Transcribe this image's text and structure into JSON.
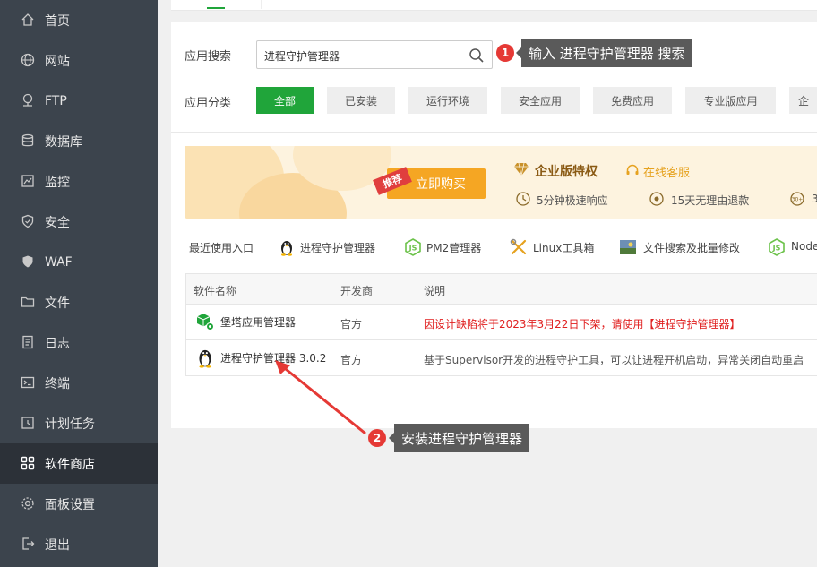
{
  "sidebar": {
    "items": [
      {
        "label": "首页",
        "icon": "home-icon"
      },
      {
        "label": "网站",
        "icon": "globe-icon"
      },
      {
        "label": "FTP",
        "icon": "ftp-icon"
      },
      {
        "label": "数据库",
        "icon": "database-icon"
      },
      {
        "label": "监控",
        "icon": "monitor-icon"
      },
      {
        "label": "安全",
        "icon": "shield-icon"
      },
      {
        "label": "WAF",
        "icon": "waf-shield-icon"
      },
      {
        "label": "文件",
        "icon": "folder-icon"
      },
      {
        "label": "日志",
        "icon": "log-icon"
      },
      {
        "label": "终端",
        "icon": "terminal-icon"
      },
      {
        "label": "计划任务",
        "icon": "clock-icon"
      },
      {
        "label": "软件商店",
        "icon": "apps-grid-icon",
        "active": true
      },
      {
        "label": "面板设置",
        "icon": "gear-icon"
      },
      {
        "label": "退出",
        "icon": "logout-icon"
      }
    ]
  },
  "search": {
    "label": "应用搜索",
    "value": "进程守护管理器"
  },
  "category": {
    "label": "应用分类",
    "items": [
      "全部",
      "已安装",
      "运行环境",
      "安全应用",
      "免费应用",
      "专业版应用",
      "企"
    ]
  },
  "banner": {
    "badge": "推荐",
    "buy": "立即购买",
    "title": "企业版特权",
    "service": "在线客服",
    "perk1": "5分钟极速响应",
    "perk2": "15天无理由退款",
    "perk3": "3"
  },
  "recent": {
    "label": "最近使用入口",
    "items": [
      "进程守护管理器",
      "PM2管理器",
      "Linux工具箱",
      "文件搜索及批量修改",
      "Node"
    ]
  },
  "table": {
    "headers": [
      "软件名称",
      "开发商",
      "说明"
    ],
    "rows": [
      {
        "name": "堡塔应用管理器",
        "dev": "官方",
        "desc": "因设计缺陷将于2023年3月22日下架，请使用【进程守护管理器】"
      },
      {
        "name": "进程守护管理器 3.0.2",
        "dev": "官方",
        "desc": "基于Supervisor开发的进程守护工具，可以让进程开机启动，异常关闭自动重启"
      }
    ]
  },
  "annotations": {
    "step1_num": "1",
    "step1_text": "输入 进程守护管理器 搜索",
    "step2_num": "2",
    "step2_text": "安装进程守护管理器"
  },
  "colors": {
    "accent": "#20a53a",
    "sidebar": "#3c444d",
    "warning": "#e02020",
    "annotation": "#e53935"
  }
}
